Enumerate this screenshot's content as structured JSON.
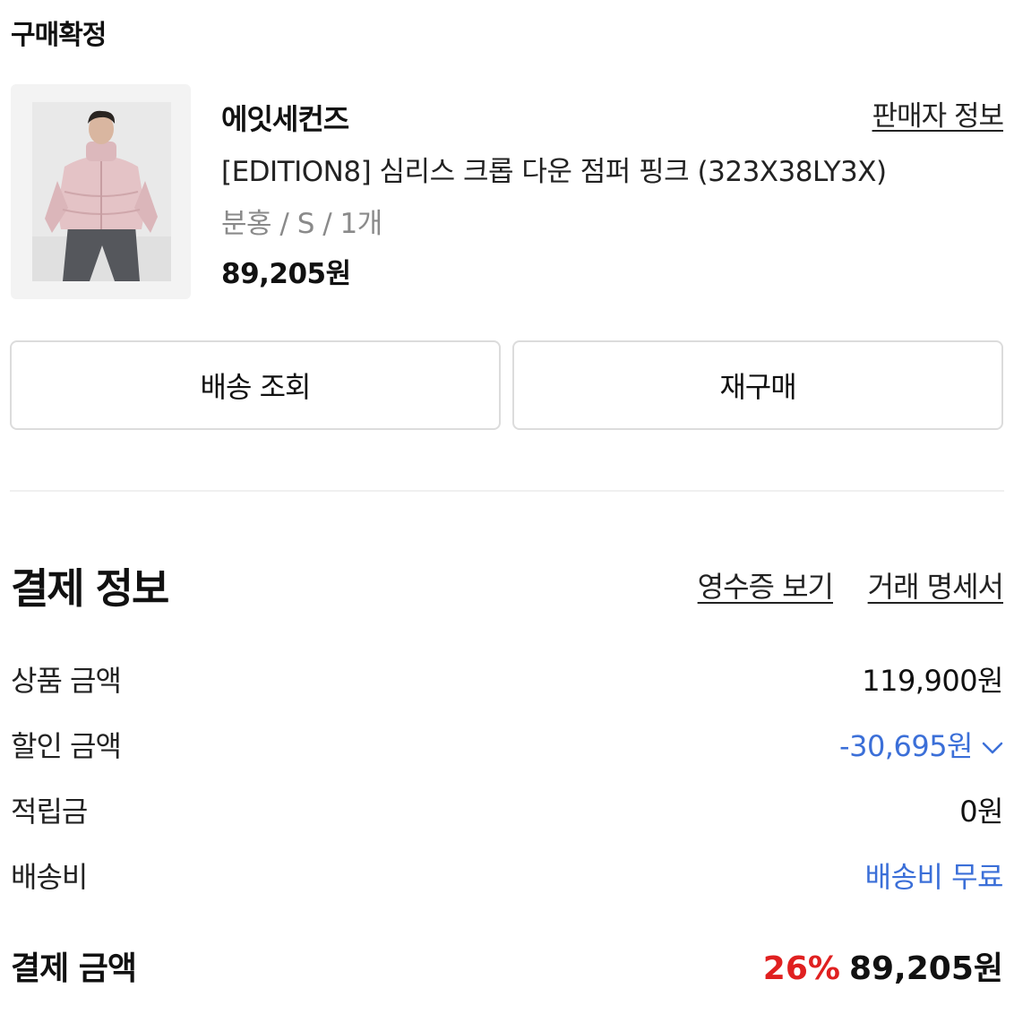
{
  "order": {
    "status": "구매확정",
    "seller_name": "에잇세컨즈",
    "seller_info_link": "판매자 정보",
    "product_name": "[EDITION8] 심리스 크롭 다운 점퍼 핑크 (323X38LY3X)",
    "option": "분홍 / S / 1개",
    "price": "89,205원"
  },
  "actions": {
    "track_delivery": "배송 조회",
    "rebuy": "재구매"
  },
  "payment": {
    "title": "결제 정보",
    "receipt_link": "영수증 보기",
    "statement_link": "거래 명세서",
    "rows": [
      {
        "label": "상품 금액",
        "value": "119,900원"
      },
      {
        "label": "할인 금액",
        "value": "-30,695원"
      },
      {
        "label": "적립금",
        "value": "0원"
      },
      {
        "label": "배송비",
        "value": "배송비 무료"
      }
    ],
    "total_label": "결제 금액",
    "discount_rate": "26%",
    "total_value": "89,205원"
  },
  "colors": {
    "accent_blue": "#3b6fd8",
    "discount_red": "#e02020"
  },
  "icons": {
    "discount_toggle": "chevron-down-icon"
  }
}
